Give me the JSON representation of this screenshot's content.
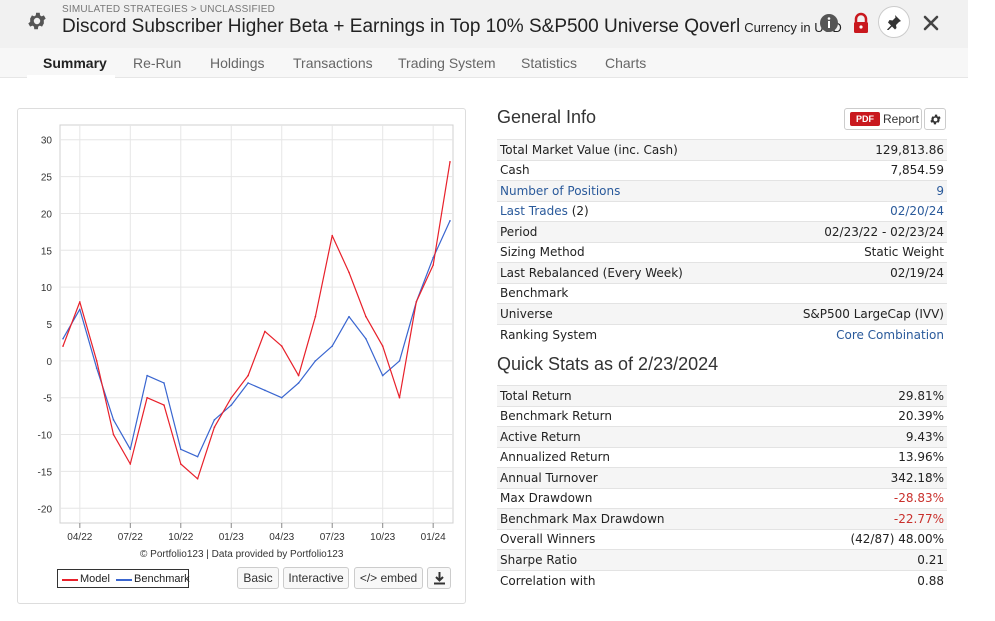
{
  "header": {
    "breadcrumb": "SIMULATED STRATEGIES > UNCLASSIFIED",
    "title": "Discord Subscriber Higher Beta + Earnings in Top 10% S&P500 Universe Qoverl",
    "currency": "Currency in USD"
  },
  "tabs": [
    "Summary",
    "Re-Run",
    "Holdings",
    "Transactions",
    "Trading System",
    "Statistics",
    "Charts"
  ],
  "chart_data": {
    "type": "line",
    "title": "",
    "xlabel": "",
    "ylabel": "",
    "x": [
      "03/22",
      "04/22",
      "05/22",
      "06/22",
      "07/22",
      "08/22",
      "09/22",
      "10/22",
      "11/22",
      "12/22",
      "01/23",
      "02/23",
      "03/23",
      "04/23",
      "05/23",
      "06/23",
      "07/23",
      "08/23",
      "09/23",
      "10/23",
      "11/23",
      "12/23",
      "01/24",
      "02/24"
    ],
    "series": [
      {
        "name": "Model",
        "color": "#e8212b",
        "values": [
          2,
          8,
          0,
          -10,
          -14,
          -5,
          -6,
          -14,
          -16,
          -9,
          -5,
          -2,
          4,
          2,
          -2,
          6,
          17,
          12,
          6,
          2,
          -5,
          8,
          13,
          27
        ]
      },
      {
        "name": "Benchmark",
        "color": "#3a66d0",
        "values": [
          3,
          7,
          -1,
          -8,
          -12,
          -2,
          -3,
          -12,
          -13,
          -8,
          -6,
          -3,
          -4,
          -5,
          -3,
          0,
          2,
          6,
          3,
          -2,
          0,
          8,
          14,
          19
        ]
      }
    ],
    "ylim": [
      -22,
      32
    ],
    "yticks": [
      30,
      25,
      20,
      15,
      10,
      5,
      0,
      -5,
      -10,
      -15,
      -20
    ],
    "xtick_labels": [
      "04/22",
      "07/22",
      "10/22",
      "01/23",
      "04/23",
      "07/23",
      "10/23",
      "01/24"
    ],
    "grid": true,
    "credit": "© Portfolio123 | Data provided by Portfolio123",
    "legend": [
      "Model",
      "Benchmark"
    ]
  },
  "chart_buttons": {
    "basic": "Basic",
    "interactive": "Interactive",
    "embed": "</> embed"
  },
  "general_info": {
    "title": "General Info",
    "report_label": "Report",
    "pdf_badge": "PDF",
    "rows": [
      {
        "label": "Total Market Value (inc. Cash)",
        "value": "129,813.86"
      },
      {
        "label": "Cash",
        "value": "7,854.59"
      },
      {
        "label": "Number of Positions",
        "value": "9"
      },
      {
        "label": "Last Trades",
        "label_suffix": " (2)",
        "value": "02/20/24"
      },
      {
        "label": "Period",
        "value": "02/23/22 - 02/23/24"
      },
      {
        "label": "Sizing Method",
        "value": "Static Weight"
      },
      {
        "label": "Last Rebalanced (Every Week)",
        "value": "02/19/24"
      },
      {
        "label": "Benchmark",
        "value": ""
      },
      {
        "label": "Universe",
        "value": "S&P500 LargeCap (IVV)"
      },
      {
        "label": "Ranking System",
        "value": "Core Combination"
      }
    ]
  },
  "quick_stats": {
    "title": "Quick Stats as of 2/23/2024",
    "rows": [
      {
        "label": "Total Return",
        "value": "29.81%"
      },
      {
        "label": "Benchmark Return",
        "value": "20.39%"
      },
      {
        "label": "Active Return",
        "value": "9.43%"
      },
      {
        "label": "Annualized Return",
        "value": "13.96%"
      },
      {
        "label": "Annual Turnover",
        "value": "342.18%"
      },
      {
        "label": "Max Drawdown",
        "value": "-28.83%"
      },
      {
        "label": "Benchmark Max Drawdown",
        "value": "-22.77%"
      },
      {
        "label": "Overall Winners",
        "value": "(42/87) 48.00%"
      },
      {
        "label": "Sharpe Ratio",
        "value": "0.21"
      },
      {
        "label": "Correlation with",
        "value": "0.88"
      }
    ]
  },
  "colors": {
    "accent_link": "#2a5a9b",
    "negative": "#c9302c",
    "pdf_red": "#c9181e",
    "lock_red": "#c9181e"
  },
  "icons": [
    "gear-icon",
    "info-icon",
    "lock-icon",
    "pin-icon",
    "close-icon",
    "settings-icon",
    "download-icon"
  ]
}
